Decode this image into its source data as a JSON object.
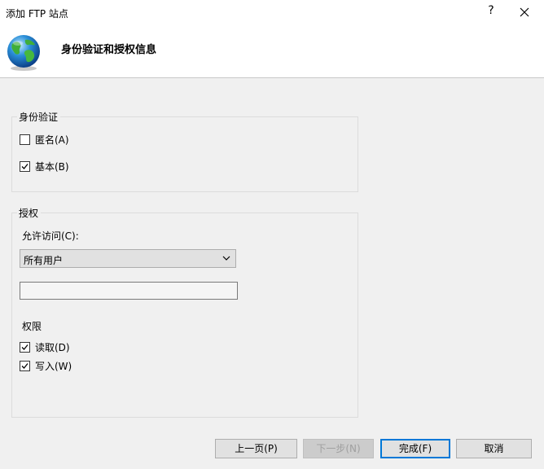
{
  "window": {
    "title": "添加 FTP 站点",
    "help_label": "?"
  },
  "header": {
    "heading": "身份验证和授权信息"
  },
  "authentication": {
    "legend": "身份验证",
    "anonymous": {
      "label": "匿名(A)",
      "checked": false
    },
    "basic": {
      "label": "基本(B)",
      "checked": true
    }
  },
  "authorization": {
    "legend": "授权",
    "allow_access_label": "允许访问(C):",
    "allow_access_value": "所有用户",
    "users_input_value": "",
    "permissions_label": "权限",
    "read": {
      "label": "读取(D)",
      "checked": true
    },
    "write": {
      "label": "写入(W)",
      "checked": true
    }
  },
  "footer": {
    "prev_label": "上一页(P)",
    "next_label": "下一步(N)",
    "finish_label": "完成(F)",
    "cancel_label": "取消"
  },
  "colors": {
    "accent": "#0078d7",
    "background": "#f0f0f0"
  }
}
